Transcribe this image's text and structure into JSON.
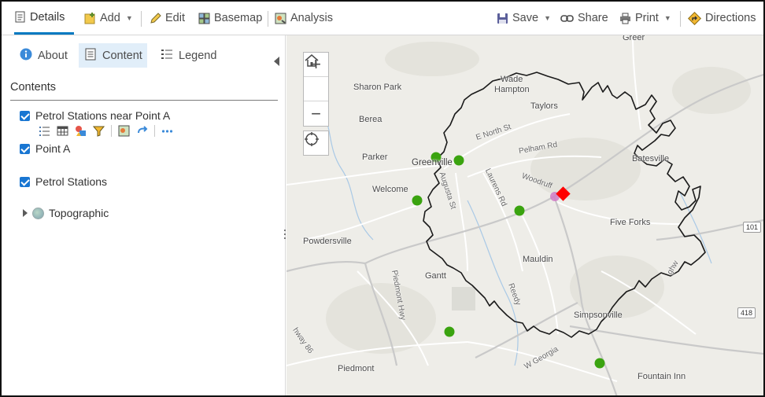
{
  "toolbar": {
    "details": "Details",
    "add": "Add",
    "edit": "Edit",
    "basemap": "Basemap",
    "analysis": "Analysis",
    "save": "Save",
    "share": "Share",
    "print": "Print",
    "directions": "Directions"
  },
  "panel": {
    "tabs": {
      "about": "About",
      "content": "Content",
      "legend": "Legend"
    },
    "contents_title": "Contents",
    "layers": [
      {
        "label": "Petrol Stations near Point A",
        "checked": true
      },
      {
        "label": "Point A",
        "checked": true
      },
      {
        "label": "Petrol Stations",
        "checked": true
      }
    ],
    "basemap_label": "Topographic"
  },
  "map": {
    "places": {
      "greer": "Greer",
      "wade_hampton": "Wade",
      "wade_hampton2": "Hampton",
      "sharon_park": "Sharon Park",
      "taylors": "Taylors",
      "berea": "Berea",
      "parker": "Parker",
      "greenville": "Greenville",
      "batesville": "Batesville",
      "welcome": "Welcome",
      "five_forks": "Five Forks",
      "powdersville": "Powdersville",
      "mauldin": "Mauldin",
      "gantt": "Gantt",
      "simpsonville": "Simpsonville",
      "piedmont": "Piedmont",
      "fountain_inn": "Fountain Inn"
    },
    "roads": {
      "e_north": "E North St",
      "pelham": "Pelham Rd",
      "augusta": "Augusta St",
      "laurens": "Laurens Rd",
      "woodruff": "Woodruff",
      "piedmont_hwy": "Piedmont Hwy",
      "reedy": "Reedy",
      "w_georgia": "W Georgia",
      "hwy86": "hway 86",
      "highway_right": "ghw"
    },
    "shields": {
      "r101": "101",
      "r418": "418"
    },
    "colors": {
      "station": "#3aa30f",
      "point_a": "#ff0000",
      "buffer": "#1a1a1a"
    }
  }
}
